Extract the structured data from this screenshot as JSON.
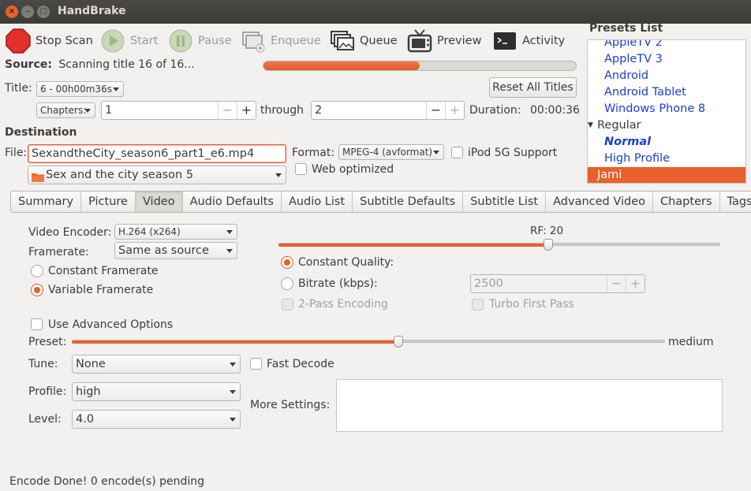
{
  "window": {
    "title": "HandBrake"
  },
  "toolbar": {
    "stop_scan": "Stop Scan",
    "start": "Start",
    "pause": "Pause",
    "enqueue": "Enqueue",
    "queue": "Queue",
    "preview": "Preview",
    "activity": "Activity"
  },
  "source": {
    "label": "Source:",
    "status": "Scanning title 16 of 16...",
    "progress_percent": 50
  },
  "title_row": {
    "label": "Title:",
    "value": "6 - 00h00m36s",
    "reset_button": "Reset All Titles"
  },
  "range": {
    "mode": "Chapters:",
    "from": "1",
    "through_label": "through",
    "to": "2",
    "duration_label": "Duration:",
    "duration": "00:00:36"
  },
  "destination": {
    "heading": "Destination",
    "file_label": "File:",
    "file_value": "SexandtheCity_season6_part1_e6.mp4",
    "folder": "Sex and the city season 5",
    "format_label": "Format:",
    "format_value": "MPEG-4 (avformat)",
    "ipod_label": "iPod 5G Support",
    "web_optimized_label": "Web optimized"
  },
  "presets": {
    "heading": "Presets List",
    "items_top": [
      "AppleTV 2",
      "AppleTV 3",
      "Android",
      "Android Tablet",
      "Windows Phone 8"
    ],
    "group": "Regular",
    "group_items": [
      "Normal",
      "High Profile"
    ],
    "selected": "Jami"
  },
  "tabs": [
    "Summary",
    "Picture",
    "Video",
    "Audio Defaults",
    "Audio List",
    "Subtitle Defaults",
    "Subtitle List",
    "Advanced Video",
    "Chapters",
    "Tags"
  ],
  "active_tab": "Video",
  "video": {
    "encoder_label": "Video Encoder:",
    "encoder_value": "H.264 (x264)",
    "framerate_label": "Framerate:",
    "framerate_value": "Same as source",
    "constant_framerate": "Constant Framerate",
    "variable_framerate": "Variable Framerate",
    "rf_label": "RF: 20",
    "constant_quality": "Constant Quality:",
    "bitrate_label": "Bitrate (kbps):",
    "bitrate_value": "2500",
    "two_pass": "2-Pass Encoding",
    "turbo_first_pass": "Turbo First Pass",
    "use_advanced": "Use Advanced Options",
    "preset_label": "Preset:",
    "preset_value": "medium",
    "tune_label": "Tune:",
    "tune_value": "None",
    "fast_decode": "Fast Decode",
    "profile_label": "Profile:",
    "profile_value": "high",
    "level_label": "Level:",
    "level_value": "4.0",
    "more_settings_label": "More Settings:",
    "rf_fraction": 0.61,
    "preset_fraction": 0.55
  },
  "status_bar": "Encode Done! 0 encode(s) pending",
  "colors": {
    "accent": "#e8602c",
    "link": "#1a3fd1",
    "titlebar": "#3c3b37"
  },
  "icons": [
    "close-icon",
    "minimize-icon",
    "maximize-icon",
    "stop-icon",
    "play-icon",
    "pause-icon",
    "enqueue-icon",
    "queue-icon",
    "preview-icon",
    "terminal-icon",
    "folder-icon"
  ]
}
